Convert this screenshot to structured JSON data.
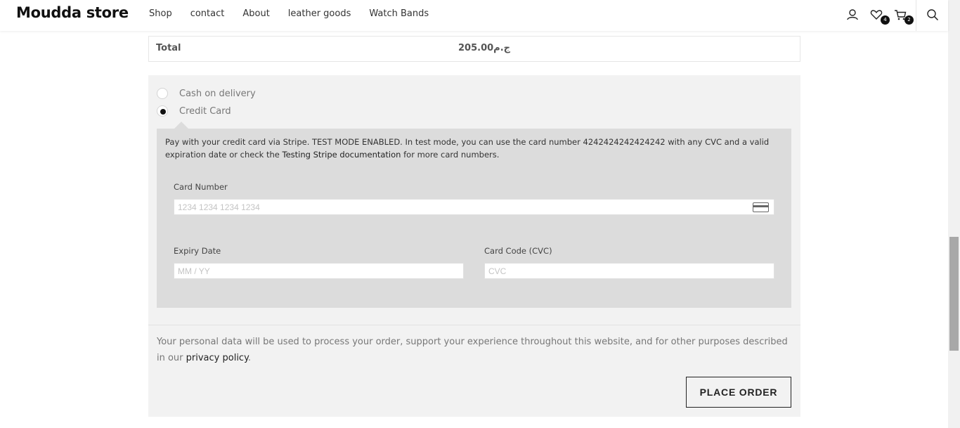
{
  "header": {
    "brand": "Moudda store",
    "nav": [
      "Shop",
      "contact",
      "About",
      "leather goods",
      "Watch Bands"
    ],
    "wishlist_count": "4",
    "cart_count": "2"
  },
  "order": {
    "total_label": "Total",
    "total_value": "205.00ج.م"
  },
  "payment": {
    "methods": [
      {
        "label": "Cash on delivery",
        "selected": false
      },
      {
        "label": "Credit Card",
        "selected": true
      }
    ],
    "description_prefix": "Pay with your credit card via Stripe. TEST MODE ENABLED. In test mode, you can use the card number 4242424242424242 with any CVC and a valid expiration date or check the ",
    "description_link": "Testing Stripe documentation",
    "description_suffix": " for more card numbers.",
    "card_number_label": "Card Number",
    "card_number_placeholder": "1234 1234 1234 1234",
    "expiry_label": "Expiry Date",
    "expiry_placeholder": "MM / YY",
    "cvc_label": "Card Code (CVC)",
    "cvc_placeholder": "CVC"
  },
  "privacy": {
    "text": "Your personal data will be used to process your order, support your experience throughout this website, and for other purposes described in our ",
    "link": "privacy policy",
    "end": "."
  },
  "place_order_label": "PLACE ORDER"
}
